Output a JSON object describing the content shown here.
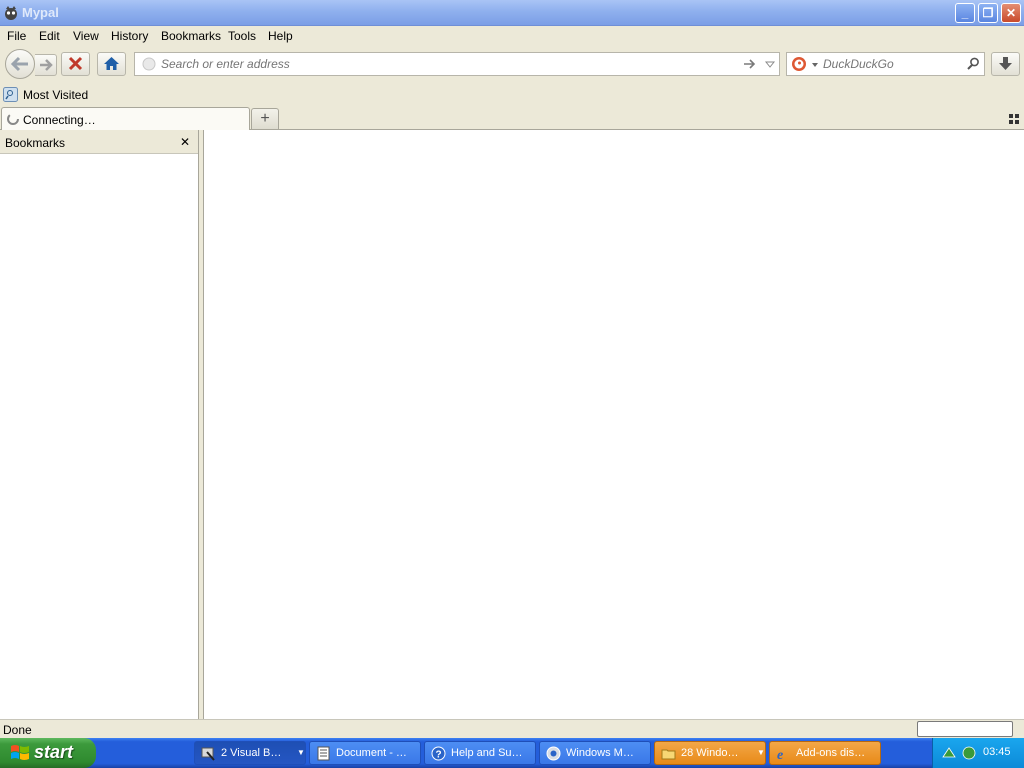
{
  "window": {
    "title": "Mypal",
    "minimize": "_",
    "restore": "❐",
    "close": "✕"
  },
  "menu": [
    "File",
    "Edit",
    "View",
    "History",
    "Bookmarks",
    "Tools",
    "Help"
  ],
  "nav": {
    "address_placeholder": "Search or enter address",
    "search_placeholder": "DuckDuckGo"
  },
  "bookmarks_toolbar": {
    "most_visited": "Most Visited"
  },
  "tabs": [
    {
      "label": "Connecting…"
    }
  ],
  "new_tab": "+",
  "sidebar": {
    "title": "Bookmarks",
    "close": "✕"
  },
  "status": {
    "text": "Done"
  },
  "taskbar": {
    "start": "start",
    "tasks": [
      {
        "label": "2 Visual B…",
        "style": "active",
        "has_dropdown": true
      },
      {
        "label": "Document - …",
        "style": "normal"
      },
      {
        "label": "Help and Su…",
        "style": "normal"
      },
      {
        "label": "Windows M…",
        "style": "normal"
      },
      {
        "label": "28 Windo…",
        "style": "orange",
        "has_dropdown": true
      },
      {
        "label": "Add-ons dis…",
        "style": "orange"
      }
    ],
    "clock": "03:45"
  },
  "colors": {
    "taskbar_blue": "#245edb",
    "start_green": "#3c9a3c",
    "title_blue": "#8fb0ee",
    "chrome_bg": "#ece9d8",
    "stop_red": "#c0392b",
    "home_blue": "#1f5fa8"
  }
}
